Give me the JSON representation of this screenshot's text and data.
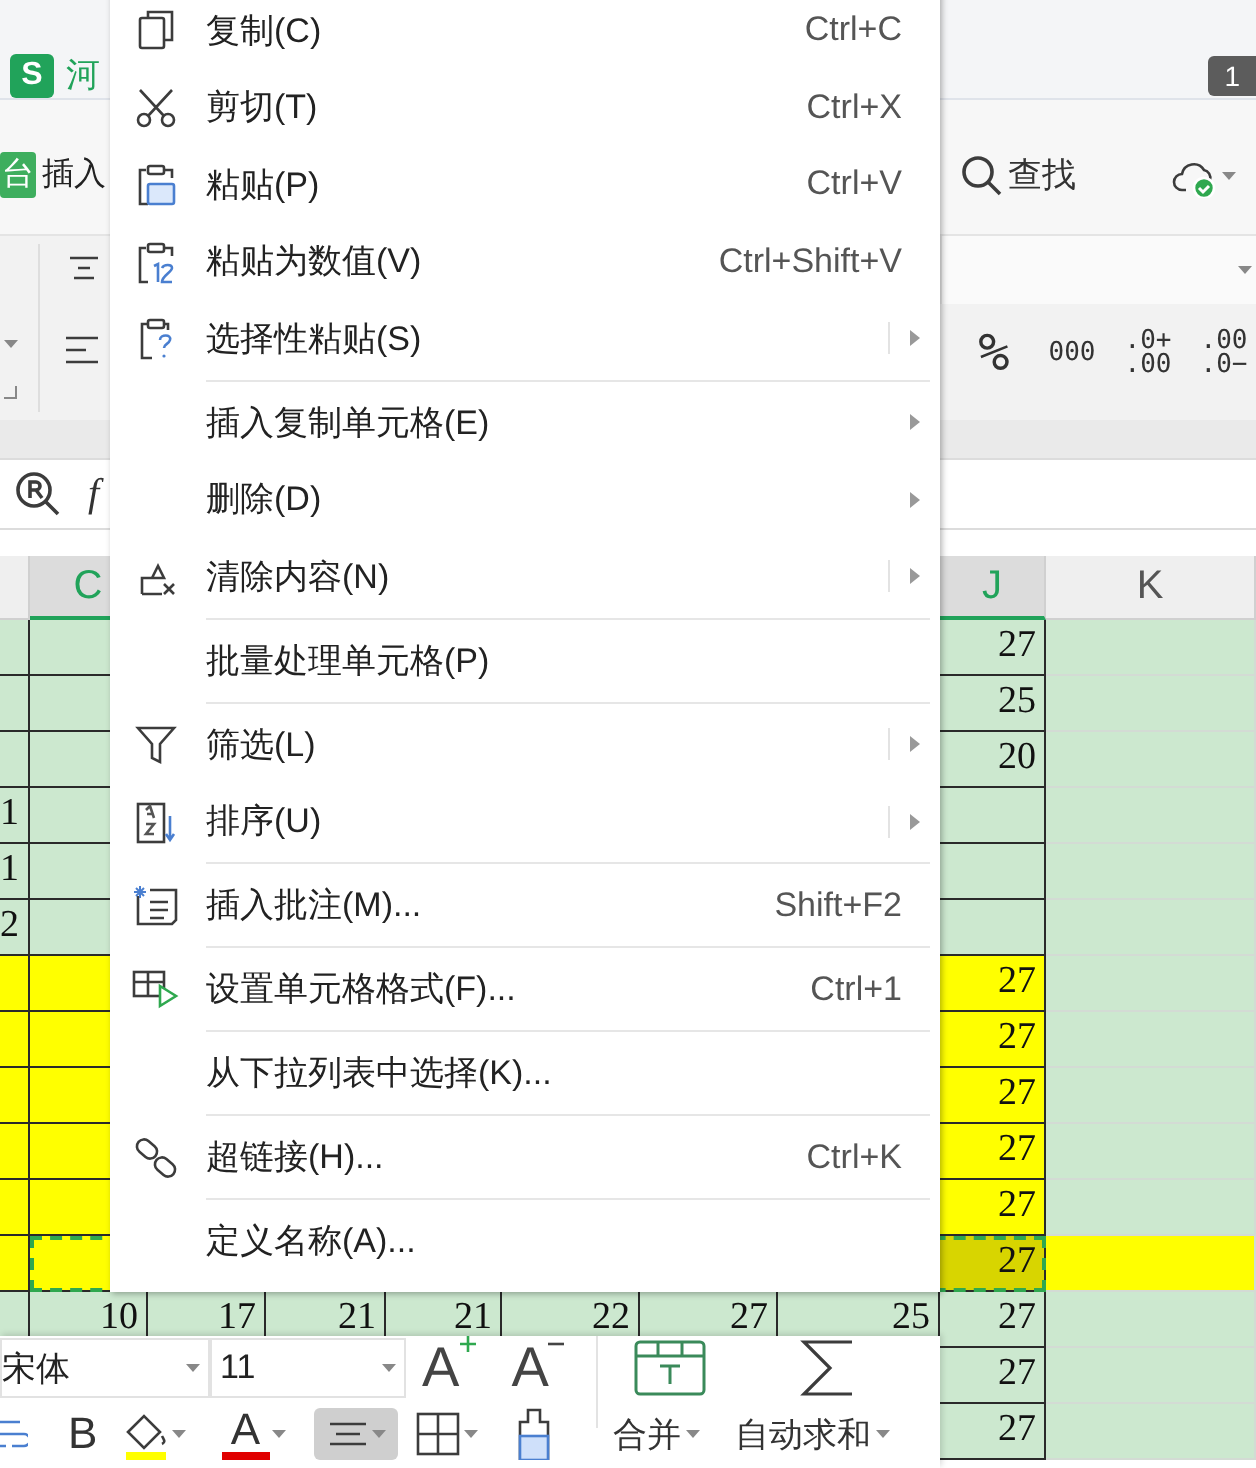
{
  "title_bar": {
    "app_logo": "S",
    "document_tab": "河",
    "badge": "1"
  },
  "ribbon_tabs": [
    {
      "label": "台",
      "selected": true
    },
    {
      "label": "插入",
      "selected": false
    }
  ],
  "find_button": {
    "label": "查找"
  },
  "number_format": [
    {
      "kind": "percent",
      "lines": [
        "%"
      ]
    },
    {
      "kind": "thousands",
      "lines": [
        "000"
      ]
    },
    {
      "kind": "decimal",
      "lines": [
        ".0+",
        ".00"
      ]
    },
    {
      "kind": "decimal",
      "lines": [
        ".00",
        ".0−"
      ]
    }
  ],
  "formula_bar": {
    "function_label": "f"
  },
  "sheet": {
    "column_headers": [
      {
        "label": "C",
        "selected": true
      },
      {
        "label": "J",
        "selected": true
      },
      {
        "label": "K",
        "selected": false
      }
    ],
    "rows": [
      {
        "kind": "plain",
        "selected": false,
        "cells": {
          "J": "27"
        }
      },
      {
        "kind": "plain",
        "selected": false,
        "cells": {
          "J": "25"
        }
      },
      {
        "kind": "plain",
        "selected": false,
        "cells": {
          "J": "20"
        }
      },
      {
        "kind": "plain",
        "selected": false,
        "cells": {
          "B": "1"
        }
      },
      {
        "kind": "plain",
        "selected": false,
        "cells": {
          "B": "1"
        }
      },
      {
        "kind": "plain",
        "selected": false,
        "cells": {
          "B": "2"
        }
      },
      {
        "kind": "highlighted",
        "selected": false,
        "cells": {
          "J": "27"
        }
      },
      {
        "kind": "highlighted",
        "selected": false,
        "cells": {
          "J": "27"
        }
      },
      {
        "kind": "highlighted",
        "selected": false,
        "cells": {
          "J": "27"
        }
      },
      {
        "kind": "highlighted",
        "selected": false,
        "cells": {
          "J": "27"
        }
      },
      {
        "kind": "highlighted",
        "selected": false,
        "cells": {
          "J": "27"
        }
      },
      {
        "kind": "highlighted_row",
        "selected": true,
        "cells": {
          "J": "27"
        }
      },
      {
        "kind": "plain",
        "selected": false,
        "cells": {
          "C": "10",
          "D": "17",
          "E": "21",
          "F": "21",
          "G": "22",
          "H": "27",
          "I": "25",
          "J": "27"
        }
      },
      {
        "kind": "plain",
        "selected": false,
        "cells": {
          "J": "27"
        }
      },
      {
        "kind": "plain",
        "selected": false,
        "cells": {
          "J": "27"
        }
      }
    ]
  },
  "context_menu": {
    "groups": [
      [
        {
          "kind": "command",
          "label": "复制(C)",
          "shortcut": "Ctrl+C"
        },
        {
          "kind": "command",
          "label": "剪切(T)",
          "shortcut": "Ctrl+X"
        },
        {
          "kind": "command",
          "label": "粘贴(P)",
          "shortcut": "Ctrl+V"
        },
        {
          "kind": "command",
          "label": "粘贴为数值(V)",
          "shortcut": "Ctrl+Shift+V"
        },
        {
          "kind": "submenu",
          "label": "选择性粘贴(S)",
          "split": true
        }
      ],
      [
        {
          "kind": "submenu",
          "label": "插入复制单元格(E)",
          "split": false
        },
        {
          "kind": "submenu",
          "label": "删除(D)",
          "split": false
        },
        {
          "kind": "submenu",
          "label": "清除内容(N)",
          "split": true
        }
      ],
      [
        {
          "kind": "command",
          "label": "批量处理单元格(P)"
        }
      ],
      [
        {
          "kind": "submenu",
          "label": "筛选(L)",
          "split": true
        },
        {
          "kind": "submenu",
          "label": "排序(U)",
          "split": true
        }
      ],
      [
        {
          "kind": "command",
          "label": "插入批注(M)...",
          "shortcut": "Shift+F2"
        }
      ],
      [
        {
          "kind": "command",
          "label": "设置单元格格式(F)...",
          "shortcut": "Ctrl+1"
        }
      ],
      [
        {
          "kind": "command",
          "label": "从下拉列表中选择(K)..."
        }
      ],
      [
        {
          "kind": "command",
          "label": "超链接(H)...",
          "shortcut": "Ctrl+K"
        }
      ],
      [
        {
          "kind": "command",
          "label": "定义名称(A)..."
        }
      ]
    ]
  },
  "mini_toolbar": {
    "font_name": "宋体",
    "font_size": "11",
    "increase_font": "A",
    "decrease_font": "A",
    "bold": "B",
    "font_color": "A",
    "align_active": true,
    "merge": "合并",
    "autosum": "自动求和"
  }
}
